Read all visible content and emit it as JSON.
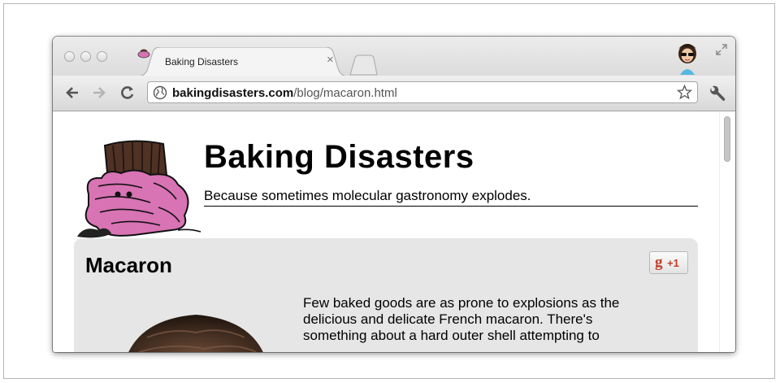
{
  "browser": {
    "tab": {
      "title": "Baking Disasters",
      "close_glyph": "×"
    },
    "address": {
      "domain": "bakingdisasters.com",
      "path": "/blog/macaron.html"
    },
    "icons": [
      "back-icon",
      "forward-icon",
      "reload-icon",
      "globe-icon",
      "bookmark-star-icon",
      "wrench-icon",
      "fullscreen-icon",
      "avatar"
    ]
  },
  "site": {
    "title": "Baking Disasters",
    "tagline": "Because sometimes molecular gastronomy explodes."
  },
  "post": {
    "title": "Macaron",
    "plusone": {
      "g": "g",
      "label": "+1"
    },
    "body_lines": [
      "Few baked goods are as prone to explosions as the",
      "delicious and delicate French macaron. There's",
      "something about a hard outer shell attempting to"
    ]
  },
  "colors": {
    "cupcake_frosting": "#d873b4",
    "cupcake_wrapper": "#5a3a2a",
    "card_bg": "#e6e6e6",
    "plusone_red": "#c23b22"
  }
}
